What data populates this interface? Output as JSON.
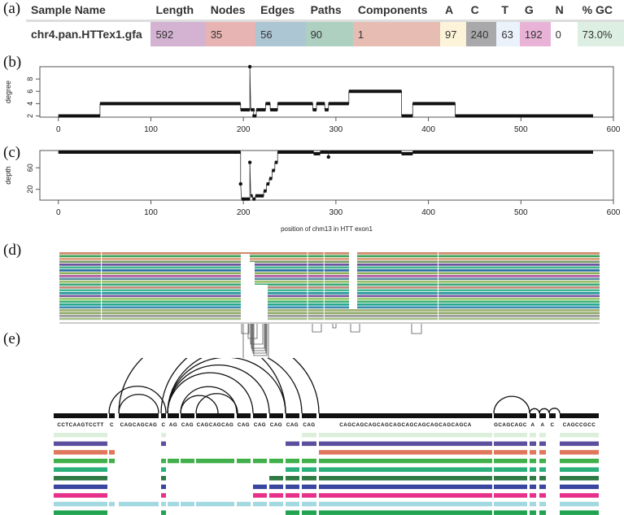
{
  "panel_labels": {
    "a": "(a)",
    "b": "(b)",
    "c": "(c)",
    "d": "(d)",
    "e": "(e)"
  },
  "table": {
    "headers": [
      "Sample Name",
      "Length",
      "Nodes",
      "Edges",
      "Paths",
      "Components",
      "A",
      "C",
      "T",
      "G",
      "N",
      "% GC"
    ],
    "row": [
      "chr4.pan.HTTex1.gfa",
      "592",
      "35",
      "56",
      "90",
      "1",
      "97",
      "240",
      "63",
      "192",
      "0",
      "73.0%"
    ],
    "cell_colors": [
      "#ffffff",
      "#d3b2d2",
      "#e8b3b3",
      "#adc6d4",
      "#add0c0",
      "#e6bcb3",
      "#fdf3d9",
      "#a9a9ab",
      "#eaf2fb",
      "#e8b3d6",
      "#ffffff",
      "#dcefe2"
    ]
  },
  "chart_data": [
    {
      "type": "line",
      "id": "degree",
      "title": "",
      "xlabel": "",
      "ylabel": "degree",
      "xlim": [
        -20,
        600
      ],
      "ylim": [
        1.8,
        10
      ],
      "xticks": [
        0,
        100,
        200,
        300,
        400,
        500,
        600
      ],
      "yticks": [
        2,
        4,
        6,
        8
      ],
      "segments": [
        {
          "x0": 0,
          "x1": 45,
          "y": 2
        },
        {
          "x0": 45,
          "x1": 197,
          "y": 4
        },
        {
          "x0": 197,
          "x1": 207,
          "y": 3
        },
        {
          "x0": 207,
          "x1": 207,
          "y": 10
        },
        {
          "x0": 208,
          "x1": 212,
          "y": 3
        },
        {
          "x0": 210,
          "x1": 214,
          "y": 2
        },
        {
          "x0": 214,
          "x1": 224,
          "y": 3
        },
        {
          "x0": 224,
          "x1": 229,
          "y": 4
        },
        {
          "x0": 229,
          "x1": 237,
          "y": 3
        },
        {
          "x0": 237,
          "x1": 275,
          "y": 4
        },
        {
          "x0": 275,
          "x1": 279,
          "y": 3
        },
        {
          "x0": 279,
          "x1": 288,
          "y": 4
        },
        {
          "x0": 288,
          "x1": 292,
          "y": 3
        },
        {
          "x0": 292,
          "x1": 314,
          "y": 4
        },
        {
          "x0": 314,
          "x1": 371,
          "y": 6
        },
        {
          "x0": 371,
          "x1": 383,
          "y": 2
        },
        {
          "x0": 383,
          "x1": 429,
          "y": 4
        },
        {
          "x0": 429,
          "x1": 578,
          "y": 2
        }
      ]
    },
    {
      "type": "line",
      "id": "depth",
      "title": "",
      "xlabel": "position of chm13 in HTT exon1",
      "ylabel": "depth",
      "xlim": [
        -20,
        600
      ],
      "ylim": [
        0,
        92
      ],
      "xticks": [
        0,
        100,
        200,
        300,
        400,
        500,
        600
      ],
      "yticks": [
        20,
        60
      ],
      "segments": [
        {
          "x0": 0,
          "x1": 197,
          "y": 89
        },
        {
          "x0": 197,
          "x1": 197,
          "y": 30
        },
        {
          "x0": 198,
          "x1": 207,
          "y": 2
        },
        {
          "x0": 207,
          "x1": 207,
          "y": 70
        },
        {
          "x0": 208,
          "x1": 210,
          "y": 8
        },
        {
          "x0": 210,
          "x1": 213,
          "y": 2
        },
        {
          "x0": 213,
          "x1": 222,
          "y": 8
        },
        {
          "x0": 222,
          "x1": 225,
          "y": 17
        },
        {
          "x0": 225,
          "x1": 228,
          "y": 30
        },
        {
          "x0": 228,
          "x1": 231,
          "y": 40
        },
        {
          "x0": 231,
          "x1": 234,
          "y": 55
        },
        {
          "x0": 234,
          "x1": 237,
          "y": 70
        },
        {
          "x0": 237,
          "x1": 276,
          "y": 89
        },
        {
          "x0": 276,
          "x1": 283,
          "y": 86
        },
        {
          "x0": 283,
          "x1": 292,
          "y": 89
        },
        {
          "x0": 292,
          "x1": 292,
          "y": 80
        },
        {
          "x0": 292,
          "x1": 371,
          "y": 89
        },
        {
          "x0": 371,
          "x1": 383,
          "y": 86
        },
        {
          "x0": 383,
          "x1": 578,
          "y": 89
        }
      ]
    },
    {
      "type": "heatmap",
      "id": "odgi-viz",
      "title": "",
      "row_colors": [
        "#d08a6a",
        "#3fa55a",
        "#d9a07a",
        "#7a9a6a",
        "#6a56a0",
        "#3fb48a",
        "#2f6ea8",
        "#8fae5a",
        "#b05aa5",
        "#5a90a0",
        "#9ec06a",
        "#3aa878",
        "#c08a7a",
        "#3fb890",
        "#2a9aa0",
        "#7a5aa0",
        "#9ac86a",
        "#3fb070",
        "#2aa890",
        "#3a8ab0",
        "#a0b070",
        "#8faa6a",
        "#9a9a9a",
        "#a8c090"
      ],
      "gap_columns_x": [
        46,
        272,
        290,
        415
      ],
      "deleted_regions": [
        [
          200,
          212
        ],
        [
          212,
          240
        ],
        [
          325,
          335
        ]
      ]
    },
    {
      "type": "table",
      "id": "sequence-tubemap",
      "node_labels": [
        "CCTCAAGTCCTT",
        "C",
        "CAGCAGCAG",
        "C",
        "AG",
        "CAG",
        "CAGCAGCAG",
        "CAG",
        "CAG",
        "CAG",
        "CAG",
        "CAG",
        "CAGCAGCAGCAGCAGCAGCAGCAGCAGCAGCA",
        "GCAGCAGC",
        "A",
        "A",
        "C",
        "CAGCCGCC"
      ],
      "path_colors": [
        "#dcefdb",
        "#5b4f9e",
        "#e0765a",
        "#3fb04a",
        "#2ab07a",
        "#2f7a44",
        "#3a45a0",
        "#e6308a",
        "#a2d8df",
        "#20a450"
      ],
      "path_presence": [
        [
          1,
          0,
          0,
          1,
          0,
          0,
          0,
          0,
          0,
          0,
          0,
          1,
          1,
          1,
          1,
          1,
          0,
          1
        ],
        [
          1,
          0,
          0,
          1,
          0,
          0,
          0,
          0,
          0,
          0,
          1,
          1,
          1,
          1,
          1,
          1,
          0,
          1
        ],
        [
          1,
          1,
          0,
          0,
          0,
          0,
          0,
          0,
          0,
          0,
          0,
          0,
          1,
          1,
          1,
          1,
          0,
          1
        ],
        [
          1,
          1,
          0,
          1,
          1,
          1,
          1,
          1,
          1,
          1,
          1,
          1,
          1,
          1,
          1,
          1,
          0,
          1
        ],
        [
          1,
          0,
          0,
          1,
          0,
          0,
          0,
          0,
          0,
          0,
          1,
          1,
          1,
          1,
          1,
          1,
          0,
          1
        ],
        [
          1,
          0,
          0,
          1,
          0,
          0,
          0,
          0,
          0,
          1,
          1,
          1,
          1,
          1,
          1,
          1,
          0,
          1
        ],
        [
          1,
          0,
          0,
          1,
          0,
          0,
          0,
          0,
          1,
          1,
          1,
          1,
          1,
          1,
          1,
          1,
          0,
          1
        ],
        [
          1,
          0,
          0,
          1,
          0,
          0,
          0,
          0,
          1,
          1,
          1,
          1,
          1,
          1,
          1,
          1,
          0,
          1
        ],
        [
          1,
          1,
          1,
          1,
          1,
          1,
          1,
          1,
          1,
          1,
          1,
          1,
          1,
          1,
          1,
          1,
          0,
          1
        ],
        [
          1,
          0,
          0,
          1,
          0,
          0,
          0,
          0,
          0,
          0,
          1,
          1,
          1,
          1,
          1,
          1,
          0,
          1
        ]
      ]
    }
  ]
}
